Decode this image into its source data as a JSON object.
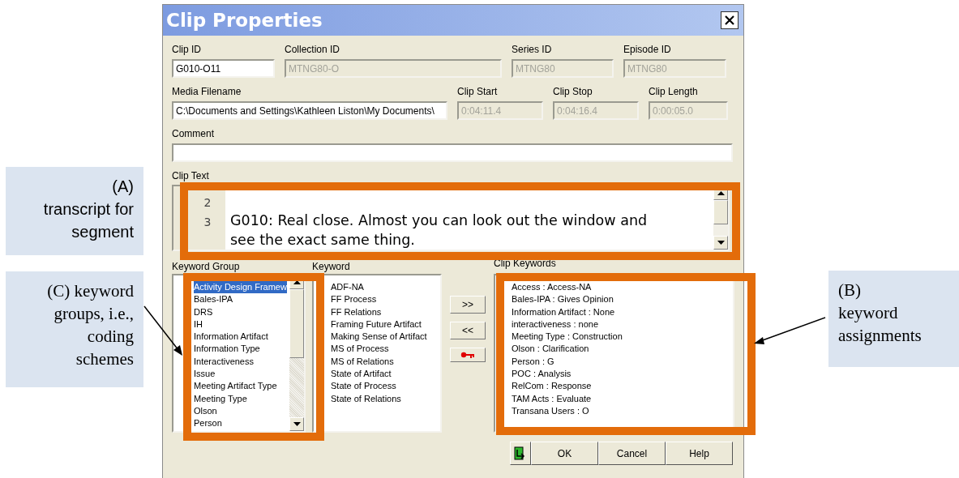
{
  "window": {
    "title": "Clip Properties"
  },
  "field_rows": [
    [
      {
        "label": "Clip ID",
        "value": "G010-O11",
        "disabled": false
      },
      {
        "label": "Collection ID",
        "value": "MTNG80-O",
        "disabled": true
      },
      {
        "label": "Series ID",
        "value": "MTNG80",
        "disabled": true
      },
      {
        "label": "Episode ID",
        "value": "MTNG80",
        "disabled": true
      }
    ],
    [
      {
        "label": "Media Filename",
        "value": "C:\\Documents and Settings\\Kathleen Liston\\My Documents\\",
        "disabled": false
      },
      {
        "label": "Clip Start",
        "value": "0:04:11.4",
        "disabled": true
      },
      {
        "label": "Clip Stop",
        "value": "0:04:16.4",
        "disabled": true
      },
      {
        "label": "Clip Length",
        "value": "0:00:05.0",
        "disabled": true
      }
    ],
    [
      {
        "label": "Comment",
        "disabled": false
      }
    ]
  ],
  "clip_text": {
    "label": "Clip Text",
    "lines": [
      {
        "number": "2"
      },
      {
        "number": "3",
        "text": "G010: Real close. Almost you can look out the window and see the exact same thing."
      }
    ]
  },
  "keyword_group": {
    "label": "Keyword Group",
    "items": [
      {
        "text": "Activity Design Framew",
        "selected": true
      },
      {
        "text": "Bales-IPA",
        "selected": false
      },
      {
        "text": "DRS",
        "selected": false
      },
      {
        "text": "IH",
        "selected": false
      },
      {
        "text": "Information Artifact",
        "selected": false
      },
      {
        "text": "Information Type",
        "selected": false
      },
      {
        "text": "Interactiveness",
        "selected": false
      },
      {
        "text": "Issue",
        "selected": false
      },
      {
        "text": "Meeting Artifact Type",
        "selected": false
      },
      {
        "text": "Meeting Type",
        "selected": false
      },
      {
        "text": "Olson",
        "selected": false
      },
      {
        "text": "Person",
        "selected": false
      }
    ]
  },
  "keyword": {
    "label": "Keyword",
    "items": [
      "ADF-NA",
      "FF Process",
      "FF Relations",
      "Framing Future Artifact",
      "Making Sense of Artifact",
      "MS of Process",
      "MS of Relations",
      "State of Artifact",
      "State of Process",
      "State of Relations"
    ]
  },
  "transfer_buttons": [
    {
      "kind": "text",
      "label": ">>"
    },
    {
      "kind": "text",
      "label": "<<"
    },
    {
      "kind": "key"
    }
  ],
  "clip_keywords": {
    "label": "Clip Keywords",
    "items": [
      "Access : Access-NA",
      "Bales-IPA : Gives Opinion",
      "Information Artifact : None",
      "interactiveness : none",
      "Meeting Type : Construction",
      "Olson : Clarification",
      "Person : G",
      "POC : Analysis",
      "RelCom : Response",
      "TAM Acts : Evaluate",
      "Transana Users : O"
    ]
  },
  "dialog_buttons": [
    "OK",
    "Cancel",
    "Help"
  ],
  "annotations": [
    {
      "kind": "sans",
      "lines": [
        "(A)",
        "transcript for",
        "segment"
      ]
    },
    {
      "kind": "serif",
      "lines": [
        "(C) keyword",
        "groups, i.e.,",
        "coding",
        "schemes"
      ]
    },
    {
      "kind": "serif",
      "lines": [
        "(B)",
        "keyword",
        "assignments"
      ]
    }
  ]
}
